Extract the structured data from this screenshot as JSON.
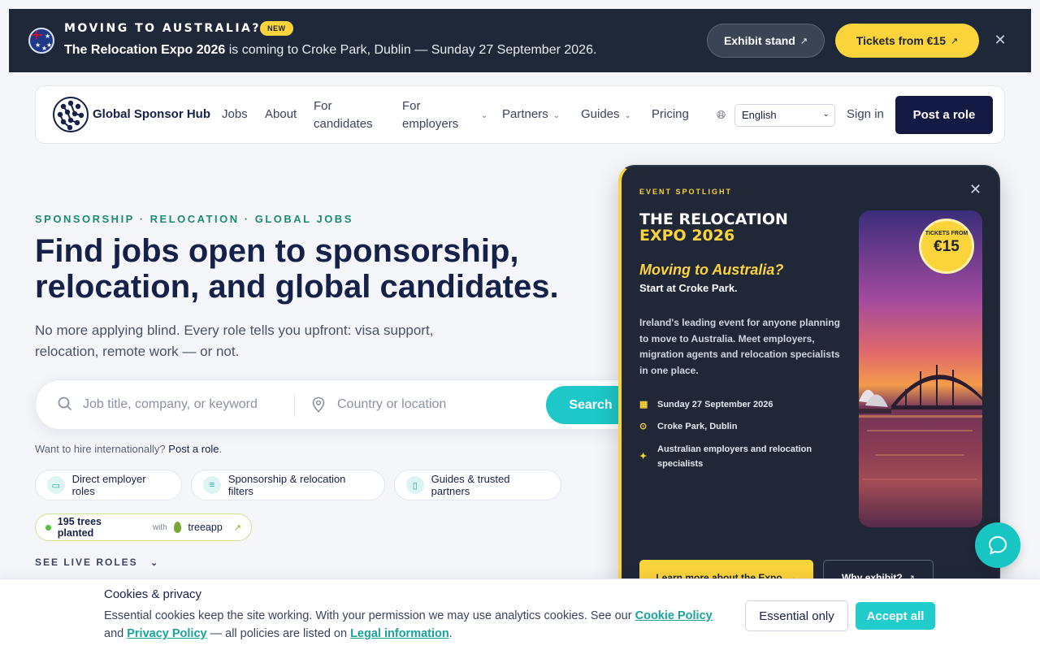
{
  "announcement": {
    "kicker": "MOVING TO AUSTRALIA?",
    "badge": "NEW",
    "message_bold": "The Relocation Expo 2026",
    "message_rest": " is coming to Croke Park, Dublin — Sunday 27 September 2026.",
    "exhibit_label": "Exhibit stand",
    "tickets_label": "Tickets from €15",
    "close_icon": "close-icon"
  },
  "nav": {
    "brand": "Global Sponsor Hub",
    "items": [
      {
        "label": "Jobs"
      },
      {
        "label": "About"
      },
      {
        "label": "For candidates"
      },
      {
        "label": "For employers"
      },
      {
        "label": "Partners"
      },
      {
        "label": "Guides"
      },
      {
        "label": "Pricing"
      }
    ],
    "language": "English",
    "sign_in": "Sign in",
    "post_role": "Post a role"
  },
  "hero": {
    "eyebrow": "SPONSORSHIP · RELOCATION · GLOBAL JOBS",
    "title": "Find jobs open to sponsorship, relocation, and global candidates.",
    "subtitle": "No more applying blind. Every role tells you upfront: visa support, relocation, remote work — or not.",
    "search": {
      "keyword_placeholder": "Job title, company, or keyword",
      "location_placeholder": "Country or location",
      "button": "Search"
    },
    "hire_prefix": "Want to hire internationally?",
    "hire_link": "Post a role",
    "hire_suffix": ".",
    "pills": [
      {
        "label": "Direct employer roles",
        "icon": "briefcase-icon"
      },
      {
        "label": "Sponsorship & relocation filters",
        "icon": "sliders-icon"
      },
      {
        "label": "Guides & trusted partners",
        "icon": "book-icon"
      }
    ],
    "trees": {
      "count_label": "195 trees planted",
      "with": "with",
      "partner": "treeapp"
    },
    "see_live": "SEE LIVE ROLES"
  },
  "event": {
    "spotlight": "EVENT SPOTLIGHT",
    "title_line1": "THE RELOCATION",
    "title_line2": "EXPO 2026",
    "moving": "Moving to Australia?",
    "start": "Start at Croke Park.",
    "description": "Ireland's leading event for anyone planning to move to Australia. Meet employers, migration agents and relocation specialists in one place.",
    "details": [
      {
        "icon": "calendar-icon",
        "text": "Sunday 27 September 2026"
      },
      {
        "icon": "location-pin-icon",
        "text": "Croke Park, Dublin"
      },
      {
        "icon": "sparkle-icon",
        "text": "Australian employers and relocation specialists"
      }
    ],
    "tickets_from": "TICKETS FROM",
    "tickets_price": "€15",
    "learn_more": "Learn more about the Expo",
    "why_exhibit": "Why exhibit?"
  },
  "cookie": {
    "title": "Cookies & privacy",
    "text_1": "Essential cookies keep the site working. With your permission we may use analytics cookies. See our ",
    "cookie_policy": "Cookie Policy",
    "text_2": " and ",
    "privacy_policy": "Privacy Policy",
    "text_3": " — all policies are listed on ",
    "legal_info": "Legal information",
    "text_4": ".",
    "essential_only": "Essential only",
    "accept_all": "Accept all"
  },
  "colors": {
    "navy": "#16214a",
    "accent_teal": "#1ec8c8",
    "accent_yellow": "#fbd33b",
    "dark_panel": "#202838"
  }
}
